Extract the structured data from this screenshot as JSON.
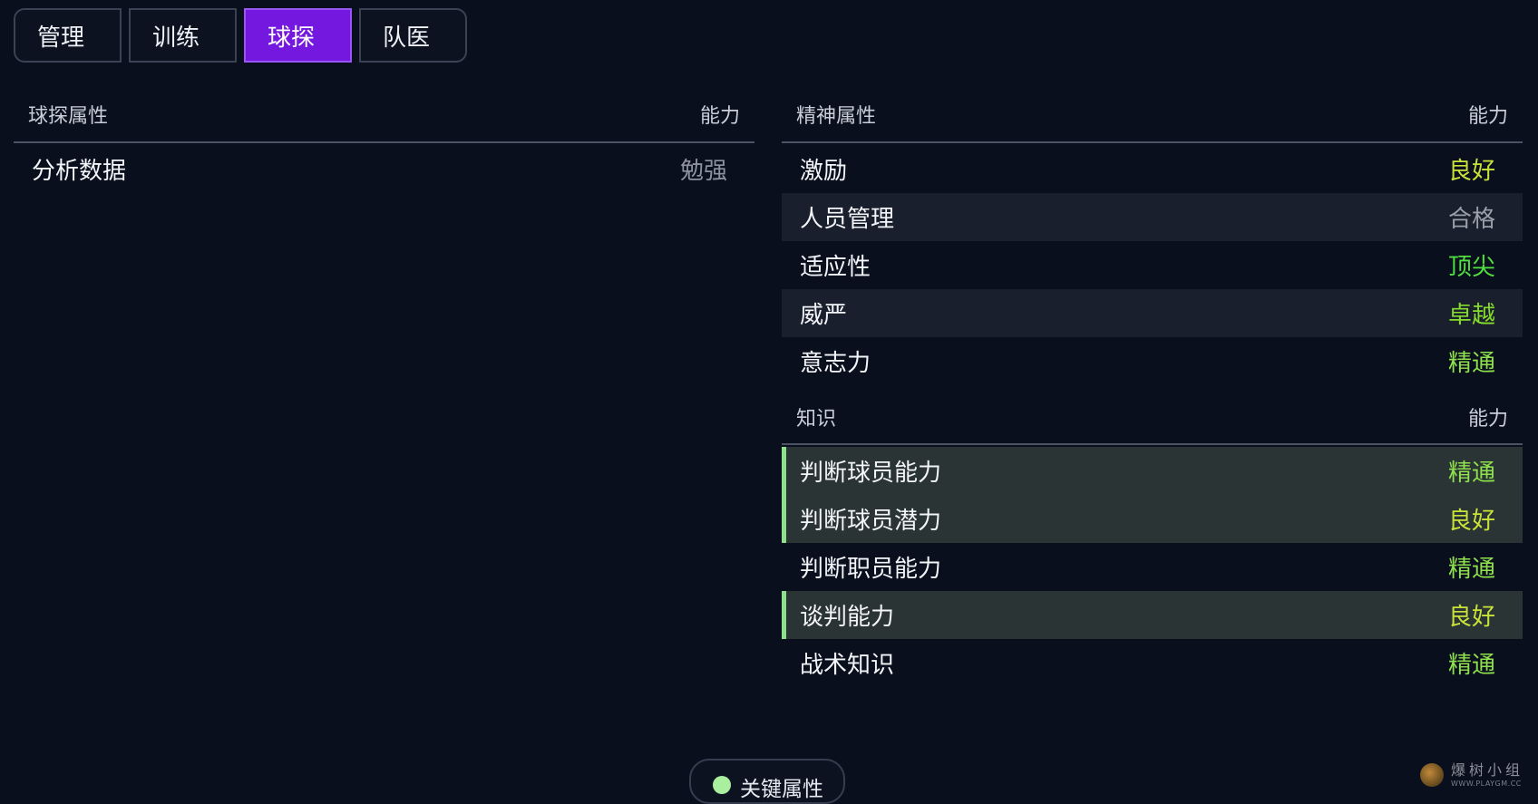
{
  "tabs": [
    {
      "label": "管理"
    },
    {
      "label": "训练"
    },
    {
      "label": "球探",
      "active": true
    },
    {
      "label": "队医"
    }
  ],
  "scouting": {
    "header": "球探属性",
    "ability_header": "能力",
    "rows": [
      {
        "name": "分析数据",
        "rating": "勉强",
        "color": "#8d939e"
      }
    ]
  },
  "mental": {
    "header": "精神属性",
    "ability_header": "能力",
    "rows": [
      {
        "name": "激励",
        "rating": "良好",
        "color": "#c9e23a"
      },
      {
        "name": "人员管理",
        "rating": "合格",
        "color": "#9aa0aa"
      },
      {
        "name": "适应性",
        "rating": "顶尖",
        "color": "#4fdf3e"
      },
      {
        "name": "威严",
        "rating": "卓越",
        "color": "#86dc2d"
      },
      {
        "name": "意志力",
        "rating": "精通",
        "color": "#8fe04d"
      }
    ]
  },
  "knowledge": {
    "header": "知识",
    "ability_header": "能力",
    "rows": [
      {
        "name": "判断球员能力",
        "rating": "精通",
        "color": "#8fe04d",
        "key": true
      },
      {
        "name": "判断球员潜力",
        "rating": "良好",
        "color": "#c9e23a",
        "key": true
      },
      {
        "name": "判断职员能力",
        "rating": "精通",
        "color": "#8fe04d",
        "key": false
      },
      {
        "name": "谈判能力",
        "rating": "良好",
        "color": "#c9e23a",
        "key": true
      },
      {
        "name": "战术知识",
        "rating": "精通",
        "color": "#8fe04d",
        "key": false
      }
    ]
  },
  "legend": {
    "label": "关键属性",
    "dot_color": "#a9ef9f"
  },
  "watermark": {
    "cn": "爆树小组",
    "url": "WWW.PLAYGM.CC"
  }
}
